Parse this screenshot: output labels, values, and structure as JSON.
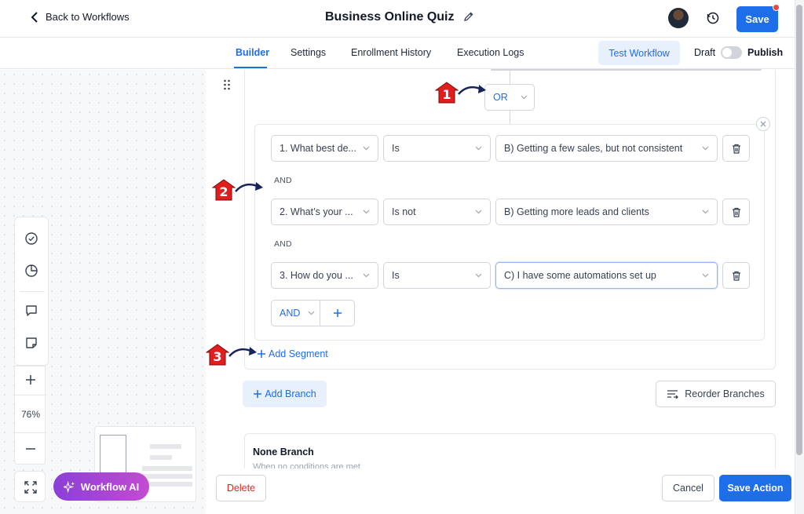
{
  "header": {
    "back_label": "Back to Workflows",
    "title": "Business Online Quiz",
    "save_label": "Save"
  },
  "tabs": [
    {
      "label": "Builder",
      "active": true
    },
    {
      "label": "Settings",
      "active": false
    },
    {
      "label": "Enrollment History",
      "active": false
    },
    {
      "label": "Execution Logs",
      "active": false
    }
  ],
  "toolbar": {
    "test_workflow_label": "Test Workflow",
    "draft_label": "Draft",
    "publish_label": "Publish",
    "publish_toggle_on": false
  },
  "canvas": {
    "zoom": "76%",
    "workflow_ai_label": "Workflow AI"
  },
  "branch": {
    "connector_operator": "OR",
    "conditions": [
      {
        "field": "1. What best de...",
        "operator": "Is",
        "value": "B) Getting a few sales, but not consistent"
      },
      {
        "field": "2. What’s your ...",
        "operator": "Is not",
        "value": "B) Getting more leads and clients"
      },
      {
        "field": "3. How do you ...",
        "operator": "Is",
        "value": "C) I have some automations set up"
      }
    ],
    "joiner_label": "AND",
    "add_operator": "AND",
    "add_segment_label": "Add Segment",
    "add_branch_label": "Add Branch",
    "reorder_label": "Reorder Branches",
    "none_branch_title": "None Branch",
    "none_branch_sub": "When no conditions are met"
  },
  "footer": {
    "delete_label": "Delete",
    "cancel_label": "Cancel",
    "save_action_label": "Save Action"
  },
  "callouts": [
    "1",
    "2",
    "3"
  ],
  "colors": {
    "accent": "#1d6ee8",
    "danger": "#dc2626",
    "callout": "#e11d1d",
    "ai_gradient_start": "#8b3fd9",
    "ai_gradient_end": "#c34bd1"
  }
}
